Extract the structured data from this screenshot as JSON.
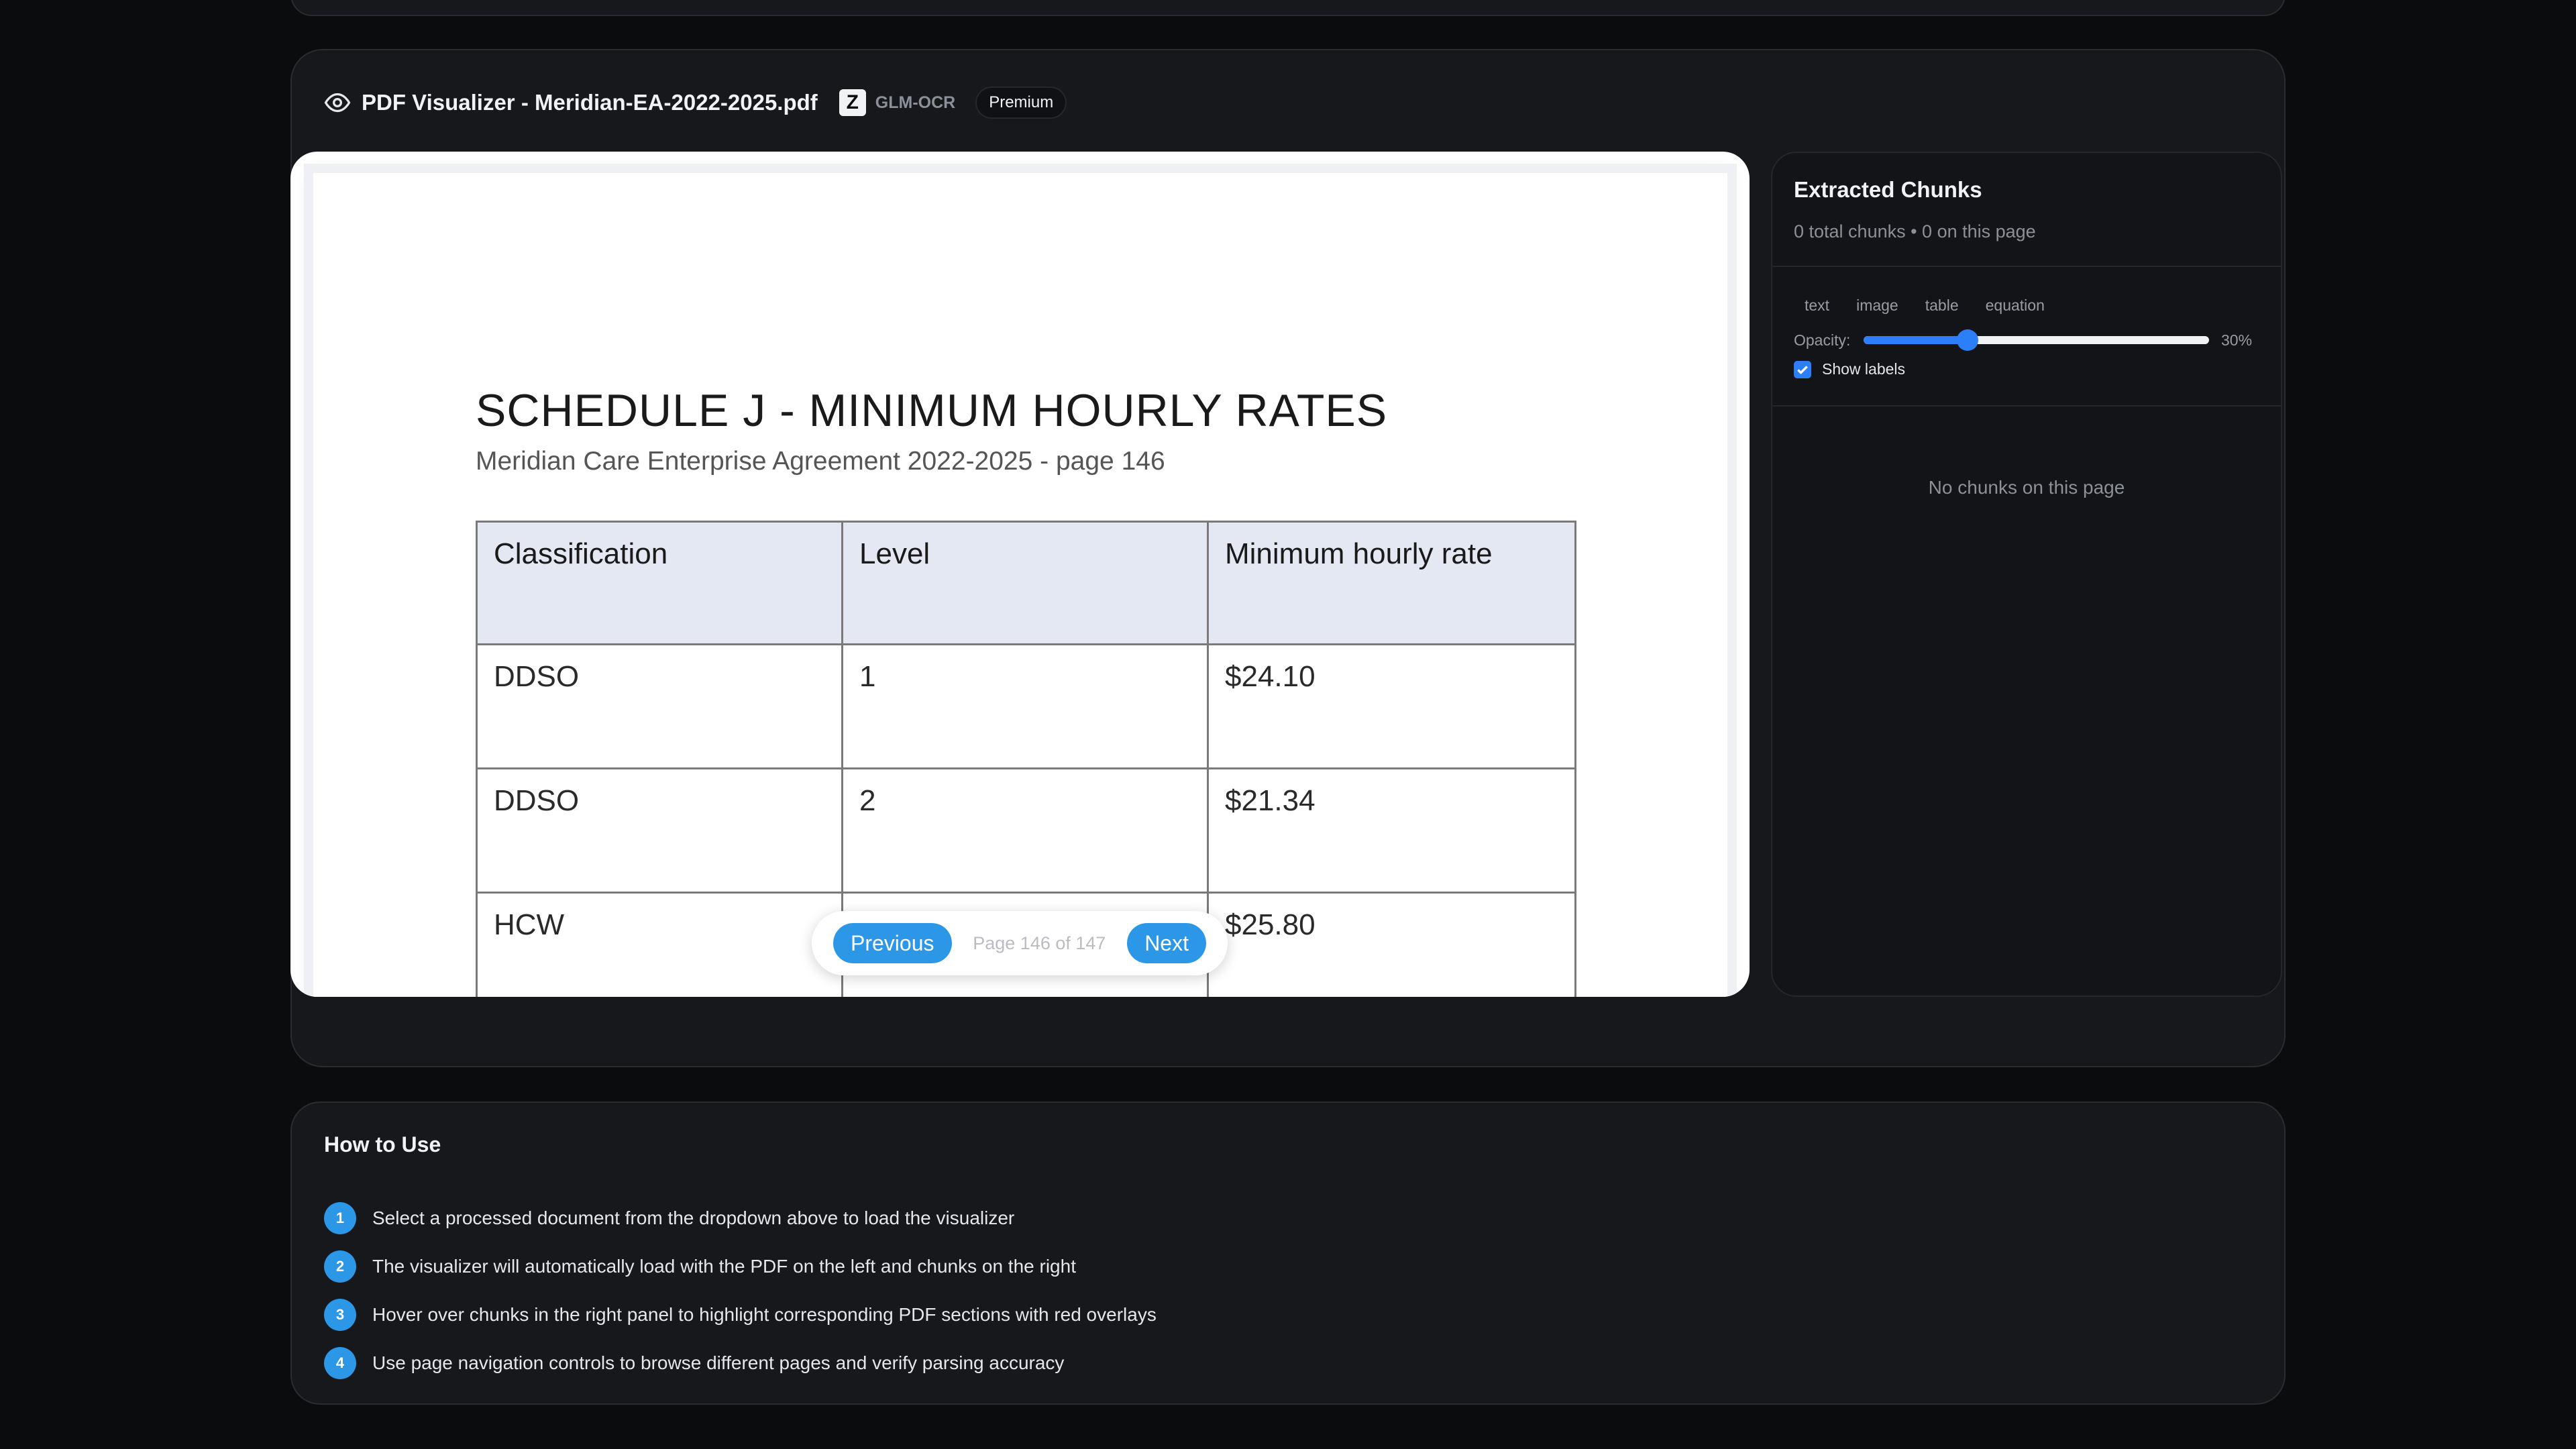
{
  "visualizer": {
    "title": "PDF Visualizer - Meridian-EA-2022-2025.pdf",
    "logo_letter": "Z",
    "model": "GLM-OCR",
    "tier_badge": "Premium"
  },
  "document": {
    "heading": "SCHEDULE J - MINIMUM HOURLY RATES",
    "subheading": "Meridian Care Enterprise Agreement 2022-2025 - page 146",
    "table": {
      "headers": [
        "Classification",
        "Level",
        "Minimum hourly rate"
      ],
      "rows": [
        [
          "DDSO",
          "1",
          "$24.10"
        ],
        [
          "DDSO",
          "2",
          "$21.34"
        ],
        [
          "HCW",
          "",
          "$25.80"
        ]
      ]
    }
  },
  "pagination": {
    "previous_label": "Previous",
    "page_label": "Page 146 of 147",
    "next_label": "Next"
  },
  "chunks_panel": {
    "title": "Extracted Chunks",
    "summary": "0 total chunks • 0 on this page",
    "types": [
      "text",
      "image",
      "table",
      "equation"
    ],
    "opacity_label": "Opacity:",
    "opacity_percent": 30,
    "opacity_value": "30%",
    "show_labels": "Show labels",
    "show_labels_checked": true,
    "empty_message": "No chunks on this page"
  },
  "how_to": {
    "title": "How to Use",
    "steps": [
      {
        "n": "1",
        "text": "Select a processed document from the dropdown above to load the visualizer"
      },
      {
        "n": "2",
        "text": "The visualizer will automatically load with the PDF on the left and chunks on the right"
      },
      {
        "n": "3",
        "text": "Hover over chunks in the right panel to highlight corresponding PDF sections with red overlays"
      },
      {
        "n": "4",
        "text": "Use page navigation controls to browse different pages and verify parsing accuracy"
      }
    ]
  },
  "colors": {
    "accent": "#2b97e6",
    "slider": "#2d7ff9",
    "card_bg": "#17181c",
    "page_bg": "#0b0c0e"
  },
  "icons": {
    "visualizer": "eye-icon",
    "checkbox": "check-icon"
  }
}
